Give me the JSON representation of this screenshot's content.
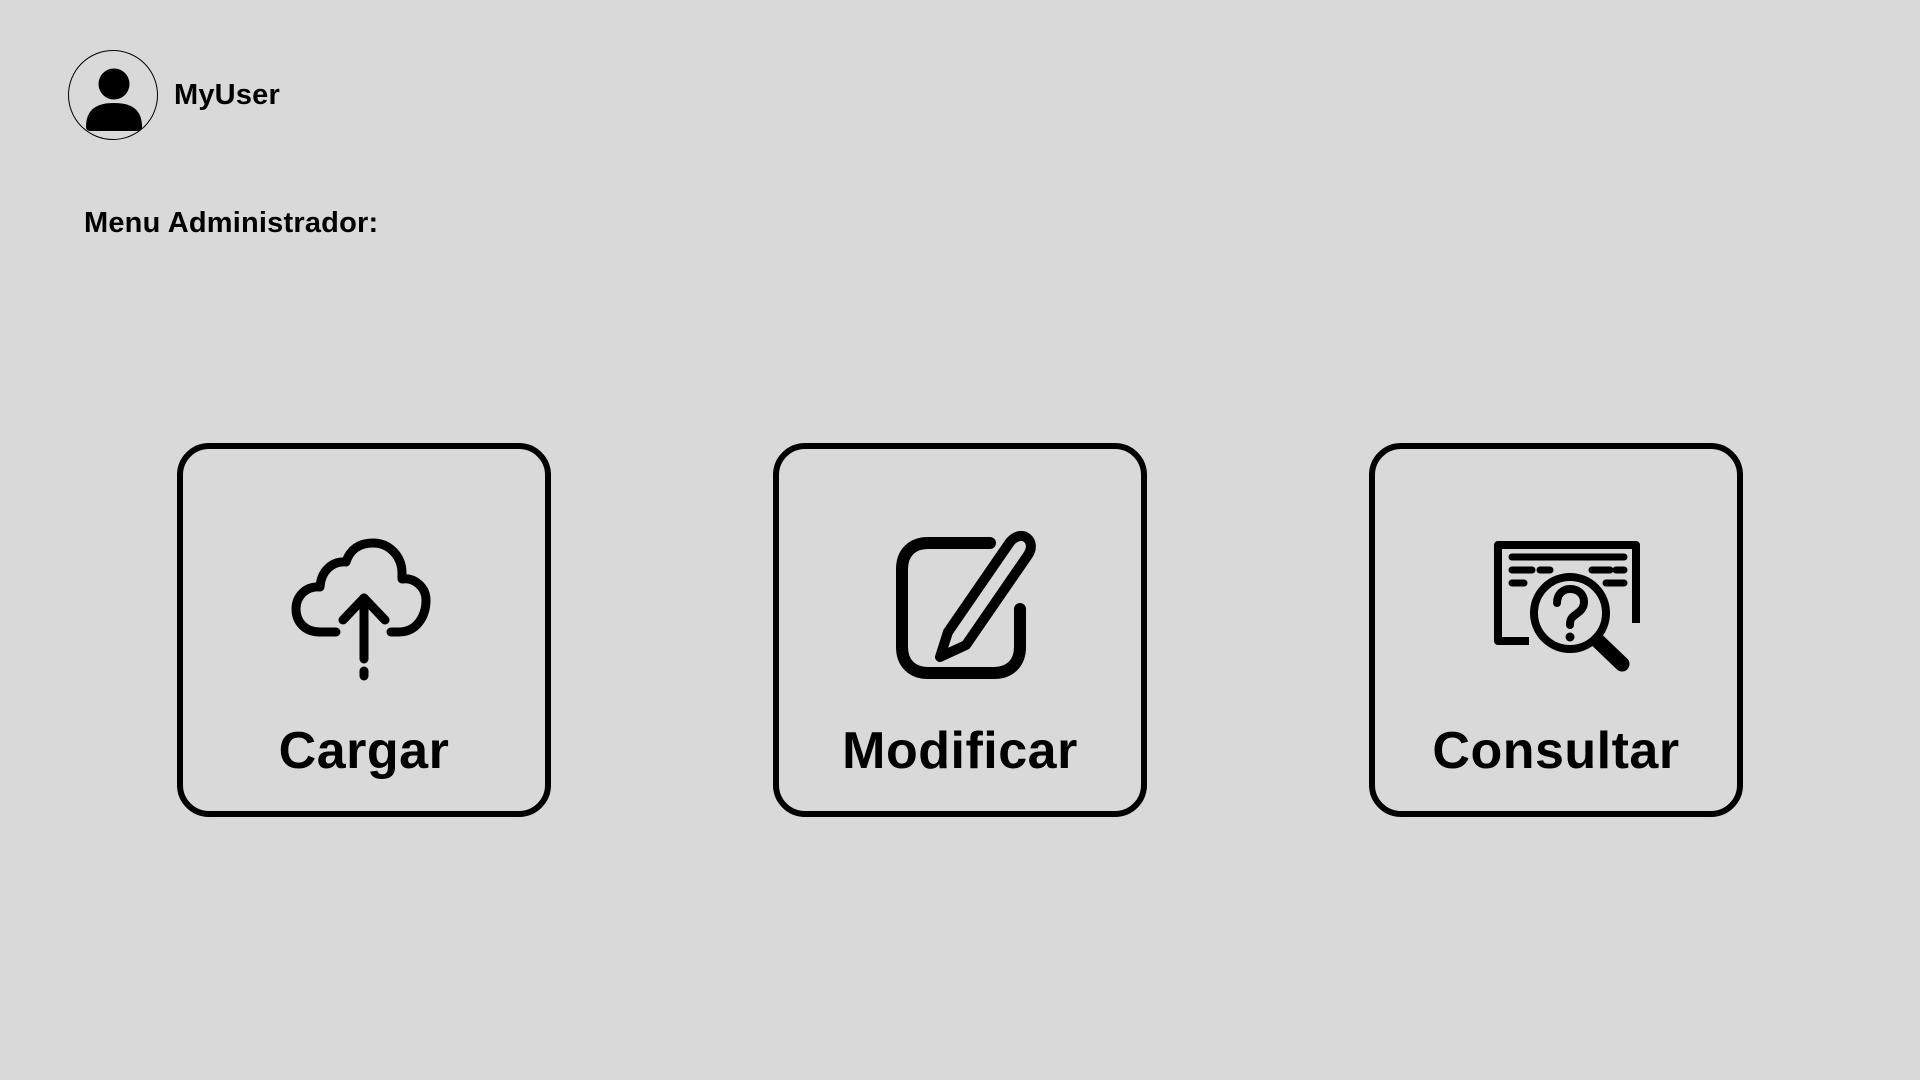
{
  "user": {
    "name": "MyUser",
    "avatar_icon": "user-icon"
  },
  "menu": {
    "title": "Menu Administrador:"
  },
  "cards": [
    {
      "label": "Cargar",
      "icon": "cloud-upload-icon"
    },
    {
      "label": "Modificar",
      "icon": "edit-icon"
    },
    {
      "label": "Consultar",
      "icon": "search-document-question-icon"
    }
  ],
  "colors": {
    "background": "#d9d9d9",
    "foreground": "#000000"
  }
}
